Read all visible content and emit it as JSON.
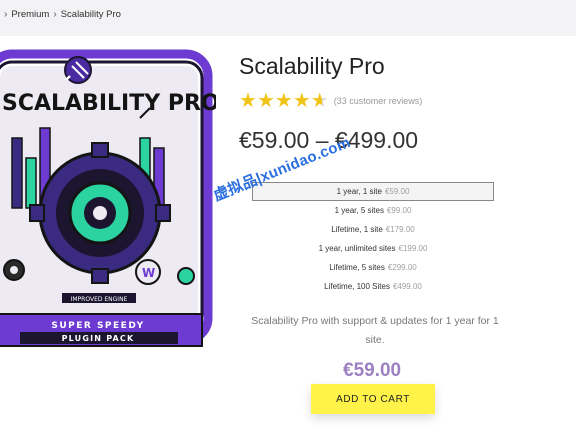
{
  "breadcrumb": {
    "items": [
      "Premium",
      "Scalability Pro"
    ]
  },
  "product": {
    "image_logo_text": "SCALABILITY PRO",
    "image_tagline_1": "SUPER SPEEDY",
    "image_tagline_2": "PLUGIN PACK",
    "image_engine_label": "IMPROVED ENGINE",
    "title": "Scalability Pro",
    "rating": 4.5,
    "rating_max": 5,
    "reviews_text": "(33 customer reviews)",
    "price_range": "€59.00 – €499.00",
    "variations": [
      {
        "label": "1 year, 1 site",
        "price": "€59.00",
        "selected": true
      },
      {
        "label": "1 year, 5 sites",
        "price": "€99.00",
        "selected": false
      },
      {
        "label": "Lifetime, 1 site",
        "price": "€179.00",
        "selected": false
      },
      {
        "label": "1 year, unlimited sites",
        "price": "€199.00",
        "selected": false
      },
      {
        "label": "Lifetime, 5 sites",
        "price": "€299.00",
        "selected": false
      },
      {
        "label": "Lifetime, 100 Sites",
        "price": "€499.00",
        "selected": false
      }
    ],
    "description": "Scalability Pro with support & updates for 1 year for 1 site.",
    "current_price": "€59.00",
    "add_to_cart_label": "ADD TO CART"
  },
  "watermark": "虚拟品|xunidao.com",
  "colors": {
    "accent_purple": "#9c82c4",
    "cart_button": "#fff34a",
    "star": "#f0c419",
    "watermark": "#2b6fe0",
    "breadcrumb_bg": "#f3f2f4"
  },
  "icons": [
    "chevron-right-icon",
    "plug-icon",
    "star-icon",
    "gear-icon"
  ]
}
